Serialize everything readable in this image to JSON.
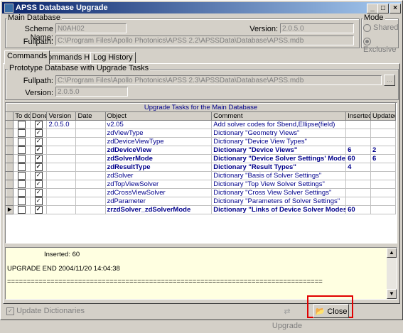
{
  "window": {
    "title": "APSS Database Upgrade"
  },
  "main_db": {
    "group_label": "Main Database",
    "scheme_label": "Scheme Name:",
    "scheme_value": "N0AH02",
    "version_label": "Version:",
    "version_value": "2.0.5.0",
    "fullpath_label": "Fullpath:",
    "fullpath_value": "C:\\Program Files\\Apollo Photonics\\APSS 2.2\\APSSData\\Database\\APSS.mdb"
  },
  "mode": {
    "group_label": "Mode",
    "shared": "Shared",
    "exclusive": "Exclusive"
  },
  "tabs": [
    "Commands",
    "Commands History",
    "Log History"
  ],
  "proto_db": {
    "group_label": "Prototype Database with Upgrade Tasks",
    "fullpath_label": "Fullpath:",
    "fullpath_value": "C:\\Program Files\\Apollo Photonics\\APSS 2.3\\APSSData\\Database\\APSS.mdb",
    "version_label": "Version:",
    "version_value": "2.0.5.0"
  },
  "grid": {
    "caption": "Upgrade Tasks for the Main Database",
    "columns": [
      "To do",
      "Done",
      "Version",
      "Date",
      "Object",
      "Comment",
      "Inserted",
      "Updated"
    ],
    "rows": [
      {
        "version": "2.0.5.0",
        "object": "v2.05",
        "comment": "Add solver codes for Sbend,Ellipse(field)",
        "inserted": "",
        "updated": "",
        "bold": false,
        "current": false
      },
      {
        "version": "",
        "object": "zdViewType",
        "comment": "Dictionary \"Geometry Views\"",
        "inserted": "",
        "updated": "",
        "bold": false,
        "current": false
      },
      {
        "version": "",
        "object": "zdDeviceViewType",
        "comment": "Dictionary \"Device View Types\"",
        "inserted": "",
        "updated": "",
        "bold": false,
        "current": false
      },
      {
        "version": "",
        "object": "zdDeviceView",
        "comment": "Dictionary \"Device Views\"",
        "inserted": "6",
        "updated": "2",
        "bold": true,
        "current": false
      },
      {
        "version": "",
        "object": "zdSolverMode",
        "comment": "Dictionary \"Device Solver Settings' Modes\"",
        "inserted": "60",
        "updated": "6",
        "bold": true,
        "current": false
      },
      {
        "version": "",
        "object": "zdResultType",
        "comment": "Dictionary \"Result Types\"",
        "inserted": "4",
        "updated": "",
        "bold": true,
        "current": false
      },
      {
        "version": "",
        "object": "zdSolver",
        "comment": "Dictionary \"Basis of Solver Settings\"",
        "inserted": "",
        "updated": "",
        "bold": false,
        "current": false
      },
      {
        "version": "",
        "object": "zdTopViewSolver",
        "comment": "Dictionary \"Top View Solver Settings\"",
        "inserted": "",
        "updated": "",
        "bold": false,
        "current": false
      },
      {
        "version": "",
        "object": "zdCrossViewSolver",
        "comment": "Dictionary \"Cross View Solver Settings\"",
        "inserted": "",
        "updated": "",
        "bold": false,
        "current": false
      },
      {
        "version": "",
        "object": "zdParameter",
        "comment": "Dictionary \"Parameters of Solver Settings\"",
        "inserted": "",
        "updated": "",
        "bold": false,
        "current": false
      },
      {
        "version": "",
        "object": "zrzdSolver_zdSolverMode",
        "comment": "Dictionary \"Links of Device Solver Modes a",
        "inserted": "60",
        "updated": "",
        "bold": true,
        "current": true
      }
    ]
  },
  "log": {
    "line1": "Inserted: 60",
    "line2": "UPGRADE END 2004/11/20 14:04:38",
    "line3": "================================================================================"
  },
  "footer": {
    "update_dictionaries": "Update Dictionaries",
    "upgrade": "Upgrade",
    "close": "Close",
    "highlight_color": "#e00000"
  }
}
